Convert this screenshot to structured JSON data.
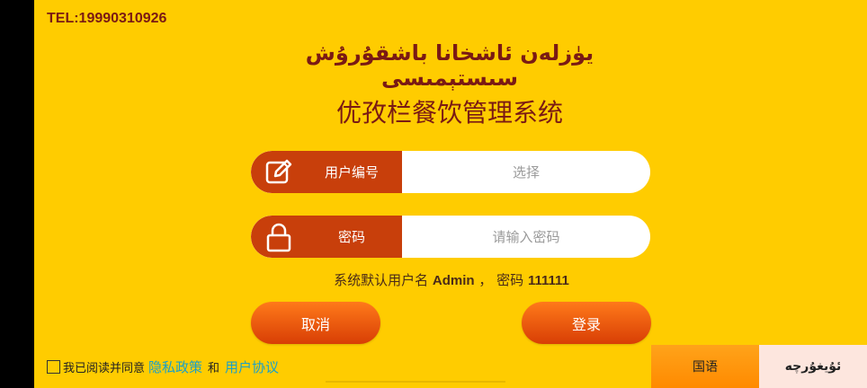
{
  "header": {
    "tel": "TEL:19990310926",
    "title_ug": "يۈزلەن ئاشخانا باشقۇرۇش سىستېمىسى",
    "title_cn": "优孜栏餐饮管理系统"
  },
  "form": {
    "user": {
      "label": "用户编号",
      "placeholder": "选择",
      "icon": "edit-icon"
    },
    "password": {
      "label": "密码",
      "placeholder": "请输入密码",
      "icon": "lock-icon"
    },
    "hint_prefix": "系统默认用户名",
    "hint_user": "Admin",
    "hint_mid": "， 密码",
    "hint_pass": "111111"
  },
  "buttons": {
    "cancel": "取消",
    "login": "登录"
  },
  "agreement": {
    "prefix": "我已阅读并同意",
    "privacy": "隐私政策",
    "and": "和",
    "user_agreement": "用户协议"
  },
  "language": {
    "chinese": "国语",
    "uyghur": "ئۇيغۇرچە"
  },
  "colors": {
    "background": "#ffcc00",
    "field_label": "#c83f0b",
    "button": "#e8540a",
    "title": "#7a1a14",
    "link": "#1aa0c8"
  }
}
